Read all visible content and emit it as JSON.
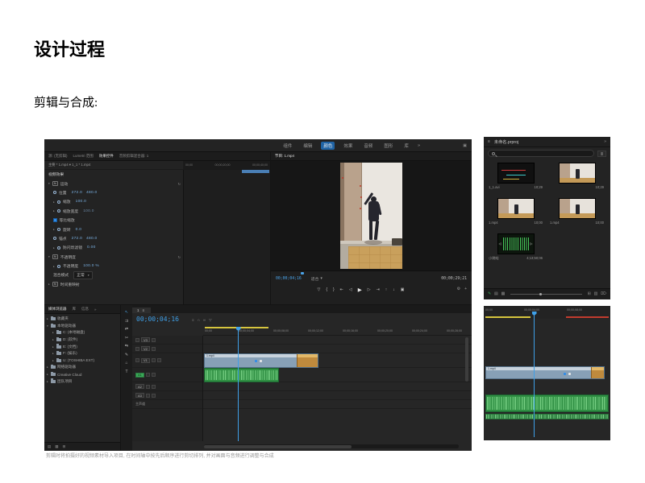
{
  "colors": {
    "accent_blue": "#2d8ceb",
    "timecode_blue": "#3fa0e8",
    "clip_video": "#87a0b6",
    "clip_orange": "#bf8a3d",
    "clip_audio_green": "#2f8f43",
    "work_area_yellow": "#d6c53e",
    "render_red": "#c23b2e",
    "panel_bg": "#232323"
  },
  "page": {
    "title": "设计过程",
    "subtitle": "剪辑与合成:",
    "caption": "剪辑时将拍摄好的视频素材导入项目, 在时间轴中按先后顺序进行剪切排列, 并对画面与音频进行调整与合成"
  },
  "workspace": {
    "tabs": [
      "组件",
      "编辑",
      "颜色",
      "效果",
      "音频",
      "图形",
      "库"
    ]
  },
  "effect_controls": {
    "tabs": [
      "源: (无剪辑)",
      "Lumetri 范围",
      "效果控件",
      "音频剪辑混合器: 1"
    ],
    "clip_path": "主要 * 1.mp4 ▾  1_1 * 1.mp4",
    "ruler": [
      "00;00",
      "00;00;20;00",
      "00;00;40;00"
    ],
    "rows": [
      {
        "label": "视频效果"
      },
      {
        "label": "运动",
        "badge": "fx"
      },
      {
        "label": "位置",
        "value": "272.0   480.0"
      },
      {
        "label": "缩放",
        "value": "100.0"
      },
      {
        "label": "缩放宽度",
        "value": "100.0"
      },
      {
        "label": "等比缩放"
      },
      {
        "label": "旋转",
        "value": "0.0"
      },
      {
        "label": "锚点",
        "value": "272.0   480.0"
      },
      {
        "label": "防闪烁滤镜",
        "value": "0.00"
      },
      {
        "label": "不透明度",
        "badge": "fx"
      },
      {
        "label": "不透明度",
        "value": "100.0 %"
      },
      {
        "label": "混合模式",
        "value": "正常"
      },
      {
        "label": "时间重映射",
        "badge": "fx"
      }
    ]
  },
  "program": {
    "tab": "节目: 1.mp4",
    "current_tc": "00;00;04;16",
    "fit_label": "适合",
    "total_tc": "00;00;29;21"
  },
  "project": {
    "title": "未命名.prproj",
    "items": [
      {
        "name": "1_1.avi",
        "duration": "10;29"
      },
      {
        "name": "",
        "duration": "10;29"
      },
      {
        "name": "1.mp4",
        "duration": "10;00"
      },
      {
        "name": "1.mp4",
        "duration": "10;00"
      },
      {
        "name": "小跳蛙",
        "duration": "4;13;50;06"
      }
    ]
  },
  "media_browser": {
    "tabs": [
      "媒体浏览器",
      "库",
      "信息"
    ],
    "tree": [
      {
        "label": "收藏夹"
      },
      {
        "label": "本地驱动器"
      },
      {
        "label": "C: (本地磁盘)"
      },
      {
        "label": "D: (软件)"
      },
      {
        "label": "E: (文档)"
      },
      {
        "label": "F: (娱乐)"
      },
      {
        "label": "U: (TOSHIBA EXT)"
      },
      {
        "label": "网络驱动器"
      },
      {
        "label": "Creative Cloud"
      },
      {
        "label": "团队项目"
      }
    ]
  },
  "timeline": {
    "sequence_tab": "1",
    "tc": "00;00;04;16",
    "ruler": [
      "00;00",
      "00;00;04;00",
      "00;00;08;00",
      "00;00;12;00",
      "00;00;16;00",
      "00;00;20;00",
      "00;00;24;00",
      "00;00;28;00"
    ],
    "video_tracks": [
      "V3",
      "V2",
      "V1"
    ],
    "audio_tracks": [
      "A1",
      "A2",
      "A3"
    ],
    "master_label": "主声道",
    "clip_video_label": "1.mp4",
    "clip_audio_label": "1.mp4"
  },
  "mini_timeline": {
    "ruler": [
      "00;00",
      "00;00;04;00",
      "00;00;08;00"
    ],
    "clip_video_label": "1.mp4"
  },
  "icons": {
    "overflow": "»",
    "panel_menu": "≡",
    "search_btn": "≣",
    "dropdown": "▾",
    "tw_open": "▾",
    "tw_closed": "▸",
    "reset": "↻",
    "add_marker": "▽",
    "mark_in": "{",
    "mark_out": "}",
    "go_to_in": "⇤",
    "step_back": "◁",
    "play": "▶",
    "step_forward": "▷",
    "go_to_out": "⇥",
    "lift": "↑",
    "extract": "↓",
    "export_frame": "▣",
    "settings": "⚙",
    "plus": "+",
    "snap": "∩",
    "link": "∞",
    "marker": "▽",
    "tool_selection": "↖",
    "tool_track_select": "⇉",
    "tool_ripple": "⇄",
    "tool_razor": "✂",
    "tool_slip": "⇆",
    "tool_pen": "✎",
    "tool_hand": "⌂",
    "tool_type": "T",
    "list_view": "▤",
    "icon_view": "▦",
    "new_item": "⊞",
    "bin": "▥",
    "trash": "⌦",
    "pencil": "✎",
    "audio_l": "◁",
    "audio_r": "▷",
    "ws_icon": "▣"
  }
}
